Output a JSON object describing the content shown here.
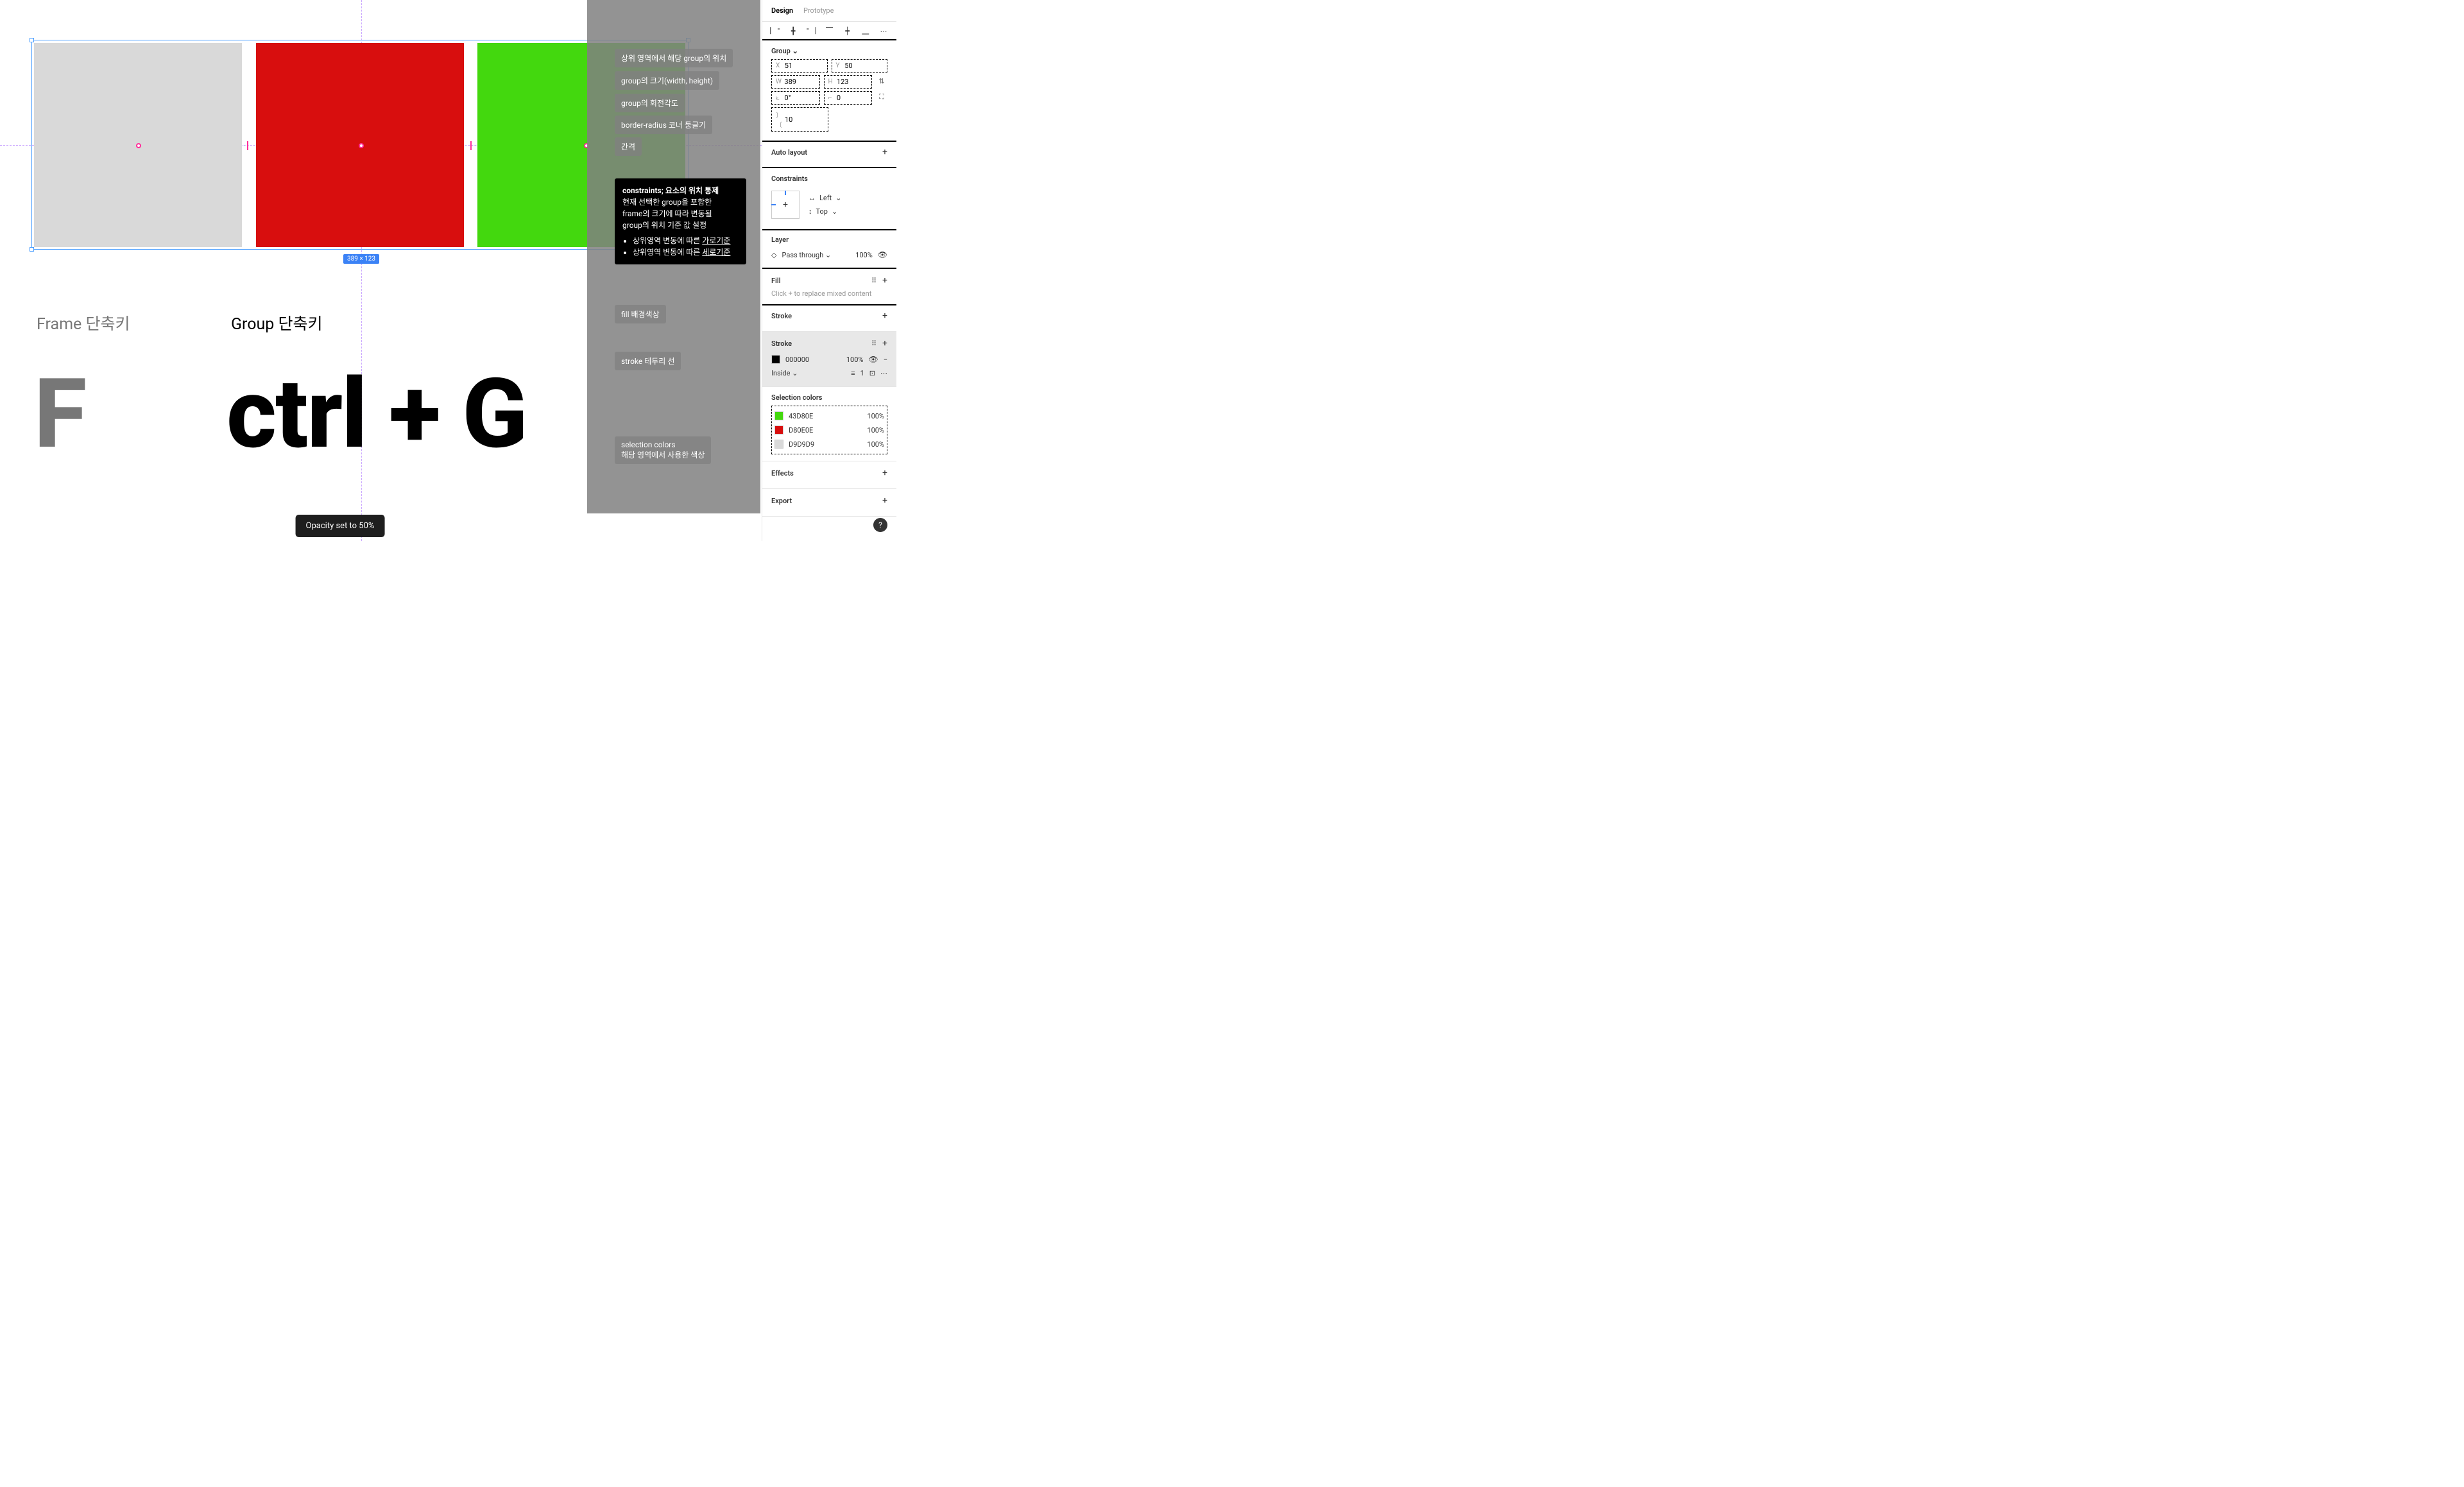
{
  "panel": {
    "tabs": {
      "design": "Design",
      "prototype": "Prototype"
    },
    "frameType": "Group",
    "transform": {
      "x_label": "X",
      "x": "51",
      "y_label": "Y",
      "y": "50",
      "w_label": "W",
      "w": "389",
      "h_label": "H",
      "h": "123",
      "rot_label": "⟀",
      "rot": "0°",
      "radius_label": "⌐",
      "radius": "0",
      "gap_label": "〕〔",
      "gap": "10"
    },
    "autoLayout": "Auto layout",
    "constraints": {
      "title": "Constraints",
      "h": "Left",
      "v": "Top"
    },
    "layer": {
      "title": "Layer",
      "blend": "Pass through",
      "opacity": "100%"
    },
    "fill": {
      "title": "Fill",
      "hint": "Click + to replace mixed content"
    },
    "stroke": {
      "title": "Stroke",
      "inline": {
        "label": "Stroke",
        "hex": "000000",
        "opacity": "100%",
        "position": "Inside",
        "width": "1"
      }
    },
    "selectionColors": {
      "title": "Selection colors",
      "items": [
        {
          "hex": "43D80E",
          "opacity": "100%"
        },
        {
          "hex": "D80E0E",
          "opacity": "100%"
        },
        {
          "hex": "D9D9D9",
          "opacity": "100%"
        }
      ]
    },
    "effects": "Effects",
    "export": "Export"
  },
  "canvas": {
    "dimBadge": "389 × 123",
    "frameTitle": "Frame 단축키",
    "groupTitle": "Group 단축키",
    "bigF": "F",
    "bigShortcut": "ctrl + G",
    "toast": "Opacity set to 50%"
  },
  "annotations": {
    "tags": [
      "상위 영역에서 해당 group의 위치",
      "group의 크기(width, height)",
      "group의 회전각도",
      "border-radius 코너 둥글기",
      "간격",
      "fill 배경색상",
      "stroke 테두리 선",
      "selection colors",
      "해당 영역에서 사용한 색상"
    ],
    "blackNote": {
      "title": "constraints; 요소의 위치 통제",
      "line1": "현재 선택한 group을 포함한",
      "line2": "frame의 크기에 따라 변동될",
      "line3": "group의 위치 기준 값 설정",
      "li1a": "상위영역 변동에 따른 ",
      "li1b": "가로기준",
      "li2a": "상위영역 변동에 따른 ",
      "li2b": "세로기준"
    }
  }
}
